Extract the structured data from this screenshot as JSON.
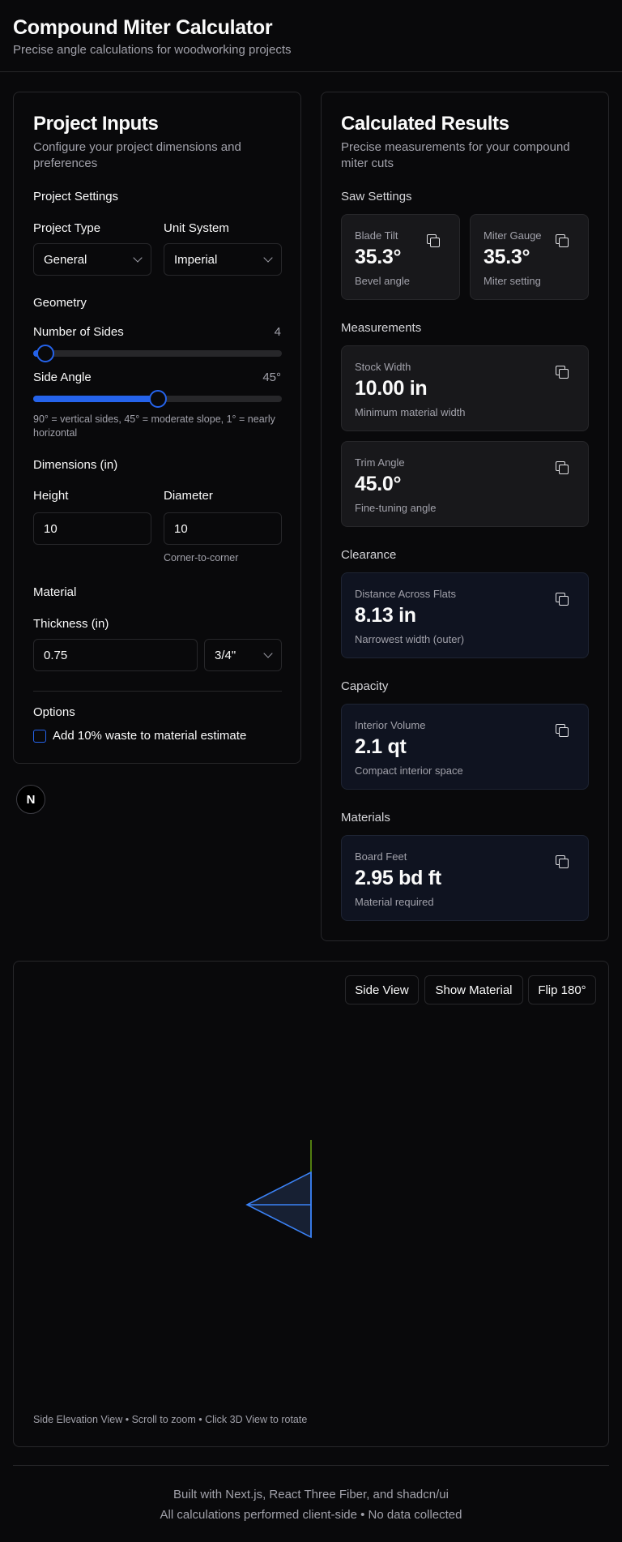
{
  "header": {
    "title": "Compound Miter Calculator",
    "subtitle": "Precise angle calculations for woodworking projects"
  },
  "inputs": {
    "title": "Project Inputs",
    "description": "Configure your project dimensions and preferences",
    "project_settings_label": "Project Settings",
    "project_type_label": "Project Type",
    "project_type_value": "General",
    "unit_system_label": "Unit System",
    "unit_system_value": "Imperial",
    "geometry_label": "Geometry",
    "sides_label": "Number of Sides",
    "sides_value": "4",
    "sides_fraction": 0.05,
    "angle_label": "Side Angle",
    "angle_value": "45°",
    "angle_fraction": 0.5,
    "angle_hint": "90° = vertical sides, 45° = moderate slope, 1° = nearly horizontal",
    "dimensions_label": "Dimensions (in)",
    "height_label": "Height",
    "height_value": "10",
    "diameter_label": "Diameter",
    "diameter_value": "10",
    "diameter_hint": "Corner-to-corner",
    "material_label": "Material",
    "thickness_label": "Thickness (in)",
    "thickness_value": "0.75",
    "thickness_preset": "3/4\"",
    "options_label": "Options",
    "waste_label": "Add 10% waste to material estimate",
    "waste_checked": false
  },
  "results": {
    "title": "Calculated Results",
    "description": "Precise measurements for your compound miter cuts",
    "saw_settings_label": "Saw Settings",
    "blade_tilt": {
      "label": "Blade Tilt",
      "value": "35.3°",
      "sub": "Bevel angle"
    },
    "miter_gauge": {
      "label": "Miter Gauge",
      "value": "35.3°",
      "sub": "Miter setting"
    },
    "measurements_label": "Measurements",
    "stock_width": {
      "label": "Stock Width",
      "value": "10.00 in",
      "sub": "Minimum material width"
    },
    "trim_angle": {
      "label": "Trim Angle",
      "value": "45.0°",
      "sub": "Fine-tuning angle"
    },
    "clearance_label": "Clearance",
    "flats": {
      "label": "Distance Across Flats",
      "value": "8.13 in",
      "sub": "Narrowest width (outer)"
    },
    "capacity_label": "Capacity",
    "volume": {
      "label": "Interior Volume",
      "value": "2.1 qt",
      "sub": "Compact interior space"
    },
    "materials_label": "Materials",
    "board_feet": {
      "label": "Board Feet",
      "value": "2.95 bd ft",
      "sub": "Material required"
    }
  },
  "viewer": {
    "side_view_label": "Side View",
    "show_material_label": "Show Material",
    "flip_label": "Flip 180°",
    "caption": "Side Elevation View • Scroll to zoom • Click 3D View to rotate"
  },
  "nextjs_badge": "N",
  "footer": {
    "line1": "Built with Next.js, React Three Fiber, and shadcn/ui",
    "line2": "All calculations performed client-side • No data collected"
  },
  "colors": {
    "accent": "#2563eb",
    "background": "#09090b",
    "border": "#27272a",
    "muted_text": "#a1a1aa",
    "axis_line": "#84cc16"
  }
}
